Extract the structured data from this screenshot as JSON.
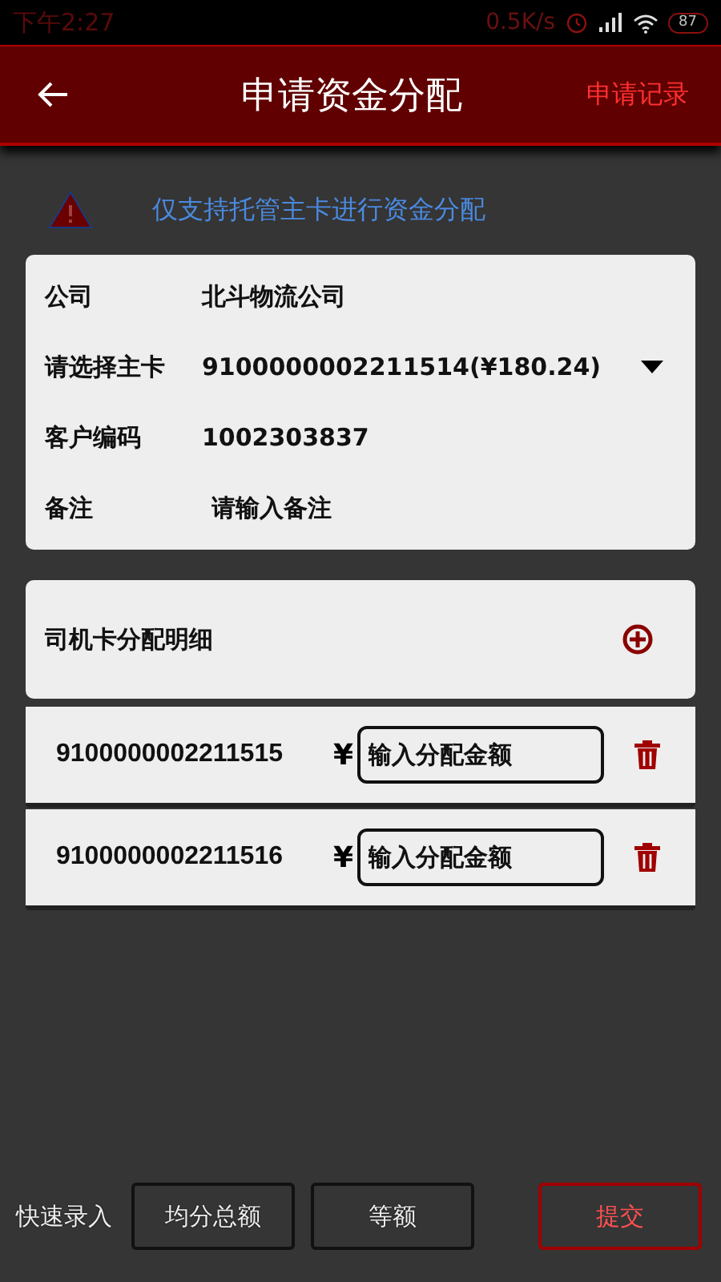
{
  "status_bar": {
    "time": "下午2:27",
    "speed": "0.5K/s",
    "battery": "87"
  },
  "header": {
    "title": "申请资金分配",
    "action": "申请记录"
  },
  "notice": "仅支持托管主卡进行资金分配",
  "form": [
    {
      "kind": "text",
      "label": "公司",
      "value": "北斗物流公司"
    },
    {
      "kind": "select",
      "label": "请选择主卡",
      "value": "9100000002211514(¥180.24)"
    },
    {
      "kind": "text",
      "label": "客户编码",
      "value": "1002303837"
    },
    {
      "kind": "input",
      "label": "备注",
      "placeholder": "请输入备注"
    }
  ],
  "detail": {
    "title": "司机卡分配明细",
    "rows": [
      {
        "card": "9100000002211515",
        "currency": "¥",
        "placeholder": "输入分配金额"
      },
      {
        "card": "9100000002211516",
        "currency": "¥",
        "placeholder": "输入分配金额"
      }
    ]
  },
  "footer": {
    "label": "快速录入",
    "buttons": [
      {
        "kind": "plain",
        "label": "均分总额"
      },
      {
        "kind": "plain",
        "label": "等额"
      },
      {
        "kind": "primary",
        "label": "提交"
      }
    ]
  }
}
